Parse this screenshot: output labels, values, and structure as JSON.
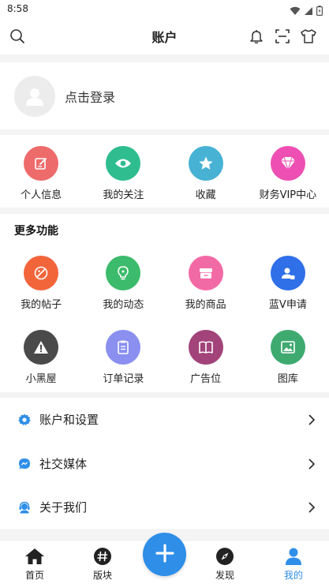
{
  "status_bar": {
    "time": "8:58",
    "icons": [
      "wifi-icon",
      "signal-icon",
      "battery-icon"
    ]
  },
  "header": {
    "title": "账户",
    "actions": [
      "bell-icon",
      "scan-icon",
      "shirt-icon"
    ]
  },
  "login": {
    "label": "点击登录"
  },
  "quick_links": [
    {
      "label": "个人信息",
      "icon": "edit-icon",
      "color": "#ee6b6b"
    },
    {
      "label": "我的关注",
      "icon": "eye-icon",
      "color": "#2fbd8f"
    },
    {
      "label": "收藏",
      "icon": "star-icon",
      "color": "#47b2d4"
    },
    {
      "label": "财务VIP中心",
      "icon": "diamond-icon",
      "color": "#ee4fb2"
    }
  ],
  "more_functions": {
    "title": "更多功能",
    "items": [
      {
        "label": "我的帖子",
        "icon": "post-icon",
        "color": "#f2643a"
      },
      {
        "label": "我的动态",
        "icon": "bulb-icon",
        "color": "#3bbb6b"
      },
      {
        "label": "我的商品",
        "icon": "goods-icon",
        "color": "#f26aa5"
      },
      {
        "label": "蓝V申请",
        "icon": "verify-icon",
        "color": "#2f6fe8"
      },
      {
        "label": "小黑屋",
        "icon": "warning-icon",
        "color": "#4a4a4a"
      },
      {
        "label": "订单记录",
        "icon": "order-icon",
        "color": "#8a8ff0"
      },
      {
        "label": "广告位",
        "icon": "book-icon",
        "color": "#a2437a"
      },
      {
        "label": "图库",
        "icon": "image-icon",
        "color": "#3eaa70"
      }
    ]
  },
  "menu": [
    {
      "label": "账户和设置",
      "icon": "gear-icon"
    },
    {
      "label": "社交媒体",
      "icon": "chat-icon"
    },
    {
      "label": "关于我们",
      "icon": "headset-icon"
    }
  ],
  "tabbar": {
    "tabs": [
      {
        "label": "首页",
        "icon": "home-icon",
        "active": false
      },
      {
        "label": "版块",
        "icon": "hash-icon",
        "active": false
      },
      {
        "label": "发现",
        "icon": "compass-icon",
        "active": false
      },
      {
        "label": "我的",
        "icon": "person-icon",
        "active": true
      }
    ],
    "fab_icon": "plus-icon"
  },
  "colors": {
    "accent": "#2e8ee8",
    "background": "#f4f4f4",
    "surface": "#ffffff",
    "text": "#222222"
  }
}
